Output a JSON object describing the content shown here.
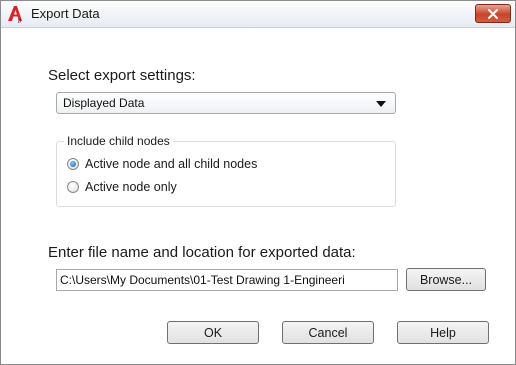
{
  "window": {
    "title": "Export Data",
    "accent": "#c7452a"
  },
  "export_settings": {
    "label": "Select export settings:",
    "selected": "Displayed Data"
  },
  "child_nodes": {
    "legend": "Include child nodes",
    "options": [
      {
        "label": "Active node and all child nodes",
        "checked": true
      },
      {
        "label": "Active node only",
        "checked": false
      }
    ]
  },
  "file": {
    "label": "Enter file name and location for exported data:",
    "value": "C:\\Users\\My Documents\\01-Test Drawing 1-Engineeri",
    "browse_label": "Browse..."
  },
  "buttons": {
    "ok": "OK",
    "cancel": "Cancel",
    "help": "Help"
  },
  "icons": {
    "app": "autocad-app-icon",
    "close": "close-icon",
    "dropdown": "chevron-down-icon"
  }
}
